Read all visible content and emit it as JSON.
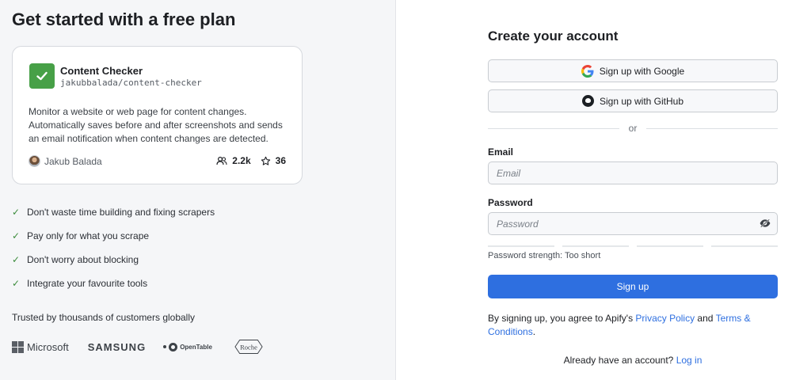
{
  "left": {
    "heading": "Get started with a free plan",
    "card": {
      "title": "Content Checker",
      "slug": "jakubbalada/content-checker",
      "description": "Monitor a website or web page for content changes. Automatically saves before and after screenshots and sends an email notification when content changes are detected.",
      "author": "Jakub Balada",
      "users": "2.2k",
      "stars": "36"
    },
    "benefits": [
      "Don't waste time building and fixing scrapers",
      "Pay only for what you scrape",
      "Don't worry about blocking",
      "Integrate your favourite tools"
    ],
    "trusted": "Trusted by thousands of customers globally",
    "logos": {
      "microsoft": "Microsoft",
      "samsung": "SAMSUNG",
      "opentable": "OpenTable",
      "roche": "Roche"
    }
  },
  "right": {
    "title": "Create your account",
    "google_button": "Sign up with Google",
    "github_button": "Sign up with GitHub",
    "divider": "or",
    "email_label": "Email",
    "email_placeholder": "Email",
    "password_label": "Password",
    "password_placeholder": "Password",
    "strength_text": "Password strength: Too short",
    "signup_button": "Sign up",
    "terms": {
      "prefix": "By signing up, you agree to Apify's ",
      "privacy": "Privacy Policy",
      "and": " and ",
      "terms": "Terms & Conditions",
      "suffix": "."
    },
    "login": {
      "prefix": "Already have an account? ",
      "link": "Log in"
    }
  },
  "colors": {
    "accent": "#2e6fe0",
    "check": "#3c8c3c",
    "card_logo": "#47a047"
  }
}
